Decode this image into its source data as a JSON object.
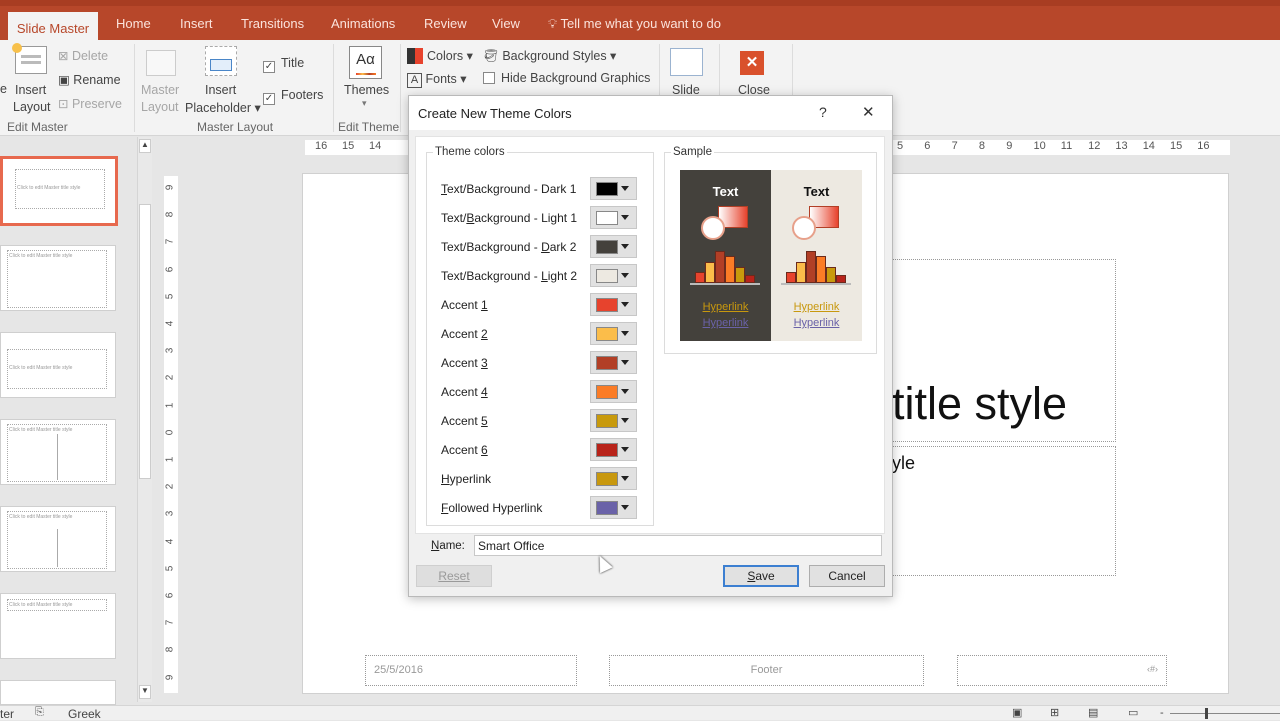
{
  "tabs": {
    "active": "Slide Master",
    "items": [
      "Home",
      "Insert",
      "Transitions",
      "Animations",
      "Review",
      "View"
    ],
    "tell_me": "Tell me what you want to do"
  },
  "ribbon": {
    "edit_master": {
      "label": "Edit Master",
      "insert_layout_1": "Insert",
      "insert_layout_2": "Layout",
      "delete": "Delete",
      "rename": "Rename",
      "preserve": "Preserve",
      "cut_left": "e"
    },
    "master_layout": {
      "label": "Master Layout",
      "master_layout_1": "Master",
      "master_layout_2": "Layout",
      "insert_placeholder_1": "Insert",
      "insert_placeholder_2": "Placeholder",
      "title_cb": "Title",
      "footers_cb": "Footers",
      "title_checked": true,
      "footers_checked": true
    },
    "edit_theme": {
      "label": "Edit Theme",
      "themes": "Themes",
      "themes_icon_text": "Aα"
    },
    "background": {
      "colors": "Colors",
      "fonts": "Fonts",
      "background_styles": "Background Styles",
      "hide_bg": "Hide Background Graphics"
    },
    "slide": "Slide",
    "close": "Close"
  },
  "ruler": {
    "h_left": [
      "16",
      "15",
      "14"
    ],
    "h_right": [
      "5",
      "6",
      "7",
      "8",
      "9",
      "10",
      "11",
      "12",
      "13",
      "14",
      "15",
      "16"
    ],
    "v": [
      "9",
      "8",
      "7",
      "6",
      "5",
      "4",
      "3",
      "2",
      "1",
      "0",
      "1",
      "2",
      "3",
      "4",
      "5",
      "6",
      "7",
      "8",
      "9"
    ]
  },
  "thumbnails": {
    "title_text": "Click to edit Master title style"
  },
  "slide": {
    "title_fragment": "title style",
    "body_fragment": "yle",
    "date": "25/5/2016",
    "footer": "Footer",
    "slide_num": "‹#›"
  },
  "status": {
    "left_text": "ter",
    "language": "Greek"
  },
  "dialog": {
    "title": "Create New Theme Colors",
    "help": "?",
    "close": "✕",
    "theme_colors_legend": "Theme colors",
    "sample_legend": "Sample",
    "rows": [
      {
        "pre": "",
        "key": "T",
        "post": "ext/Background - Dark 1",
        "color": "#000000"
      },
      {
        "pre": "Text/",
        "key": "B",
        "post": "ackground - Light 1",
        "color": "#ffffff"
      },
      {
        "pre": "Text/Background - ",
        "key": "D",
        "post": "ark 2",
        "color": "#44413c"
      },
      {
        "pre": "Text/Background - ",
        "key": "L",
        "post": "ight 2",
        "color": "#ede9e1"
      },
      {
        "pre": "Accent ",
        "key": "1",
        "post": "",
        "color": "#e7432d"
      },
      {
        "pre": "Accent ",
        "key": "2",
        "post": "",
        "color": "#fbbd4a"
      },
      {
        "pre": "Accent ",
        "key": "3",
        "post": "",
        "color": "#b23f26"
      },
      {
        "pre": "Accent ",
        "key": "4",
        "post": "",
        "color": "#fb7c26"
      },
      {
        "pre": "Accent ",
        "key": "5",
        "post": "",
        "color": "#c89a0c"
      },
      {
        "pre": "Accent ",
        "key": "6",
        "post": "",
        "color": "#b8231a"
      },
      {
        "pre": "",
        "key": "H",
        "post": "yperlink",
        "color": "#c8980e"
      },
      {
        "pre": "",
        "key": "F",
        "post": "ollowed Hyperlink",
        "color": "#6a62a8"
      }
    ],
    "sample": {
      "text": "Text",
      "hyperlink": "Hyperlink",
      "followed": "Hyperlink",
      "chart_values": [
        2,
        4,
        6,
        5,
        3,
        1.5
      ]
    },
    "name_label_key": "N",
    "name_label_rest": "ame:",
    "name_value": "Smart Office",
    "reset": "Reset",
    "save_key": "S",
    "save_rest": "ave",
    "cancel": "Cancel"
  }
}
